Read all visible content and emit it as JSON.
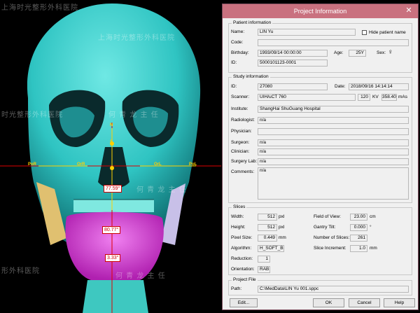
{
  "watermarks": [
    "上海时光整形外科医院",
    "何 青 龙 主 任",
    "时光整形外科医院",
    "何 青 龙 主 任",
    "上海时光整形外科医院",
    "何 青 龙 主 任",
    "形外科医院",
    "何 青 龙 主 任",
    "上海时光整形外科医院",
    "光整形外科医院"
  ],
  "landmarks": {
    "pol": "PoR",
    "orr": "OrR",
    "orl": "OrL",
    "pot": "PoL",
    "n": "N",
    "s": "S"
  },
  "angles": [
    "77.59°",
    "80.77°",
    "3.33°"
  ],
  "dialog": {
    "title": "Project Information",
    "close_glyph": "✕",
    "patient": {
      "group": "Patient information",
      "name_label": "Name:",
      "name": "LIN Yu",
      "hide_label": "Hide patient name",
      "code_label": "Code:",
      "code": "",
      "birthday_label": "Birthday:",
      "birthday": "1993/09/14 00:00:00",
      "age_label": "Age:",
      "age": "25Y",
      "sex_label": "Sex:",
      "sex_glyph": "♀",
      "id_label": "ID:",
      "id": "5000101123-0001"
    },
    "study": {
      "group": "Study information",
      "id_label": "ID:",
      "id": "27080",
      "date_label": "Date:",
      "date": "2018/09/16 14:14:14",
      "scanner_label": "Scanner:",
      "scanner": "UIH/uCT 760",
      "kv": "120",
      "kv_unit": "KV",
      "mas": "358.40",
      "mas_unit": "mAs",
      "institute_label": "Institute:",
      "institute": "ShangHai ShuGuang Hospital",
      "radiologist_label": "Radiologist:",
      "radiologist": "n/a",
      "physician_label": "Physician:",
      "physician": "",
      "surgeon_label": "Surgeon:",
      "surgeon": "n/a",
      "clinician_label": "Clinician:",
      "clinician": "n/a",
      "surgerylab_label": "Surgery Lab:",
      "surgerylab": "n/a",
      "comments_label": "Comments:",
      "comments": "n/a"
    },
    "slices": {
      "group": "Slices",
      "width_label": "Width:",
      "width": "512",
      "width_unit": "pxl",
      "height_label": "Height:",
      "height": "512",
      "height_unit": "pxl",
      "pixel_label": "Pixel Size:",
      "pixel": "0.449",
      "pixel_unit": "mm",
      "algo_label": "Algorithm:",
      "algo": "H_SOFT_B",
      "reduction_label": "Reduction:",
      "reduction": "1",
      "orientation_label": "Orientation:",
      "orientation": "RAB",
      "fov_label": "Field of View:",
      "fov": "23.00",
      "fov_unit": "cm",
      "tilt_label": "Gantry Tilt:",
      "tilt": "0.000",
      "tilt_unit": "°",
      "nslices_label": "Number of Slices:",
      "nslices": "261",
      "incr_label": "Slice Increment:",
      "incr": "1.0",
      "incr_unit": "mm"
    },
    "project": {
      "group": "Project File",
      "path_label": "Path:",
      "path": "C:\\MedData\\LIN Yu 001.sppc"
    },
    "buttons": {
      "edit": "Edit...",
      "ok": "OK",
      "cancel": "Cancel",
      "help": "Help"
    }
  }
}
